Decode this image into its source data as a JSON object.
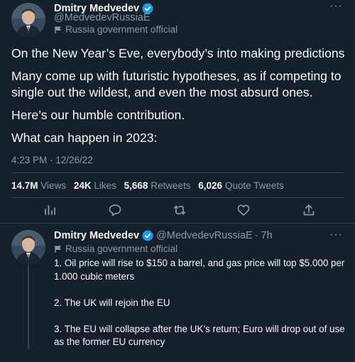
{
  "main_tweet": {
    "author": {
      "name": "Dmitry Medvedev",
      "handle": "@MedvedevRussiaE",
      "label": "Russia government official"
    },
    "paragraphs": [
      "On the New Year’s Eve, everybody’s into making predictions",
      "Many come up with futuristic hypotheses, as if competing to single out the wildest, and even the most absurd ones.",
      "Here’s our humble contribution.",
      "What can happen in 2023:"
    ],
    "timestamp": "4:23 PM · 12/26/22",
    "stats": {
      "views_count": "14.7M",
      "views_label": "Views",
      "likes_count": "24K",
      "likes_label": "Likes",
      "retweets_count": "5,668",
      "retweets_label": "Retweets",
      "quotes_count": "6,026",
      "quotes_label": "Quote Tweets"
    },
    "actions": [
      "analytics-icon",
      "reply-icon",
      "retweet-icon",
      "like-icon",
      "share-icon"
    ]
  },
  "reply_tweet": {
    "author": {
      "name": "Dmitry Medvedev",
      "handle": "@MedvedevRussiaE",
      "time": "· 7h",
      "label": "Russia government official"
    },
    "paragraphs": [
      "1.  Oil price will rise to $150 a barrel, and gas price will top $5.000 per 1.000 cubic meters",
      "2. The UK will rejoin the EU",
      "3. The EU will collapse after the UK’s return; Euro will drop out of use as the former EU currency"
    ]
  },
  "colors": {
    "background": "#15202b",
    "text": "#f7f9f9",
    "secondary": "#8b98a5",
    "divider": "#38444d",
    "verified": "#1d9bf0"
  }
}
